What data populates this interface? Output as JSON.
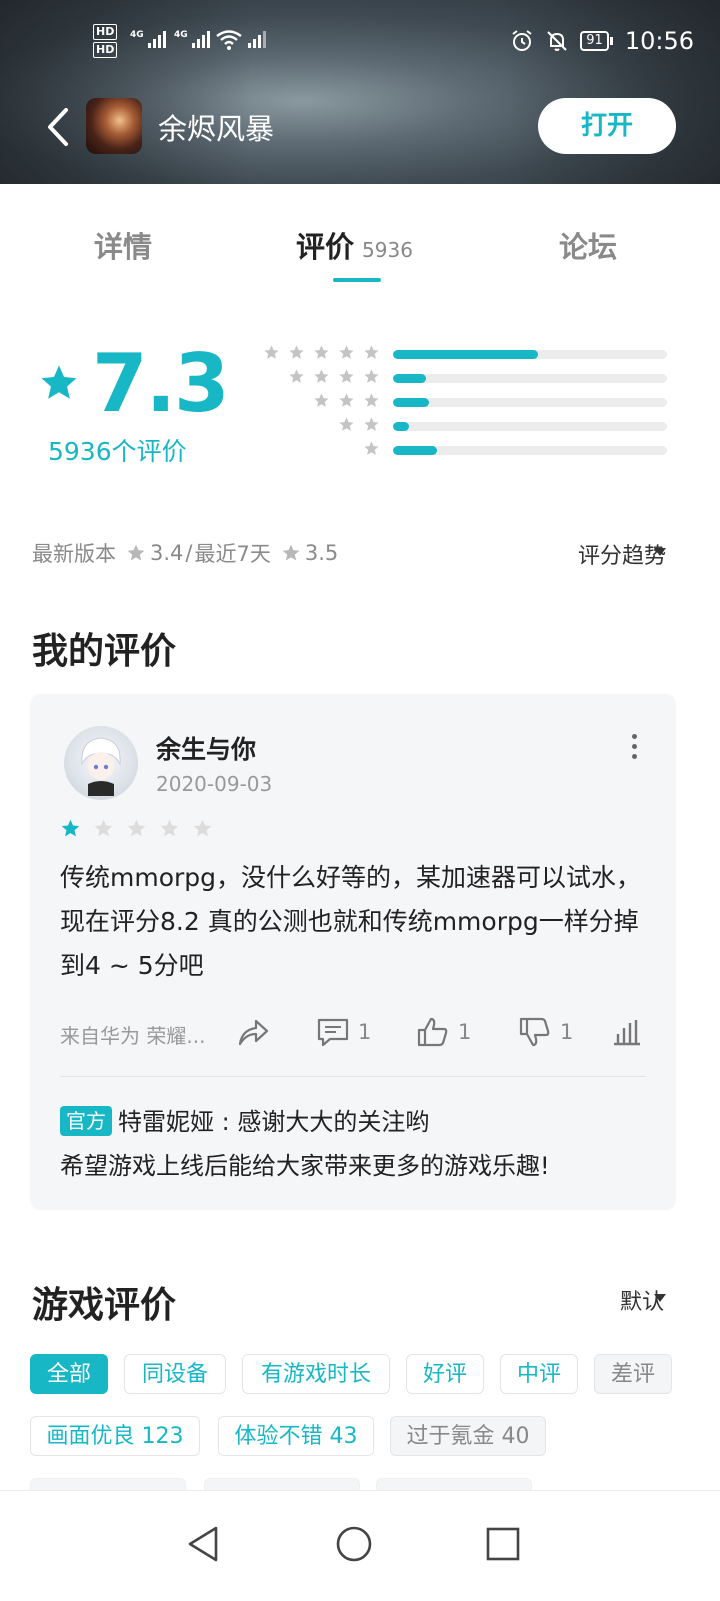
{
  "status_bar": {
    "time": "10:56",
    "battery": "91",
    "sim_labels": [
      "HD",
      "HD"
    ],
    "network_labels": [
      "4G",
      "4G"
    ]
  },
  "app_header": {
    "game_title": "余烬风暴",
    "open_button": "打开"
  },
  "tabs": [
    {
      "label": "详情"
    },
    {
      "label": "评价",
      "count": "5936"
    },
    {
      "label": "论坛"
    }
  ],
  "rating": {
    "score": "7.3",
    "count_text": "5936个评价",
    "distribution": [
      {
        "stars": 5,
        "fraction": 0.53
      },
      {
        "stars": 4,
        "fraction": 0.12
      },
      {
        "stars": 3,
        "fraction": 0.13
      },
      {
        "stars": 2,
        "fraction": 0.06
      },
      {
        "stars": 1,
        "fraction": 0.16
      }
    ],
    "latest_label": "最新版本",
    "latest_score": "3.4",
    "separator": "/",
    "recent_label": "最近7天",
    "recent_score": "3.5",
    "trend_label": "评分趋势"
  },
  "my_review": {
    "section_title": "我的评价",
    "user_name": "余生与你",
    "date": "2020-09-03",
    "stars": 1,
    "text": "传统mmorpg，没什么好等的，某加速器可以试水，现在评分8.2 真的公测也就和传统mmorpg一样分掉到4 ~ 5分吧",
    "device": "来自华为 荣耀...",
    "comment_count": "1",
    "like_count": "1",
    "dislike_count": "1",
    "official_badge": "官方",
    "official_reply_line1": "特雷妮娅 : 感谢大大的关注哟",
    "official_reply_line2": "希望游戏上线后能给大家带来更多的游戏乐趣!"
  },
  "game_reviews": {
    "section_title": "游戏评价",
    "sort_label": "默认",
    "filters": [
      "全部",
      "同设备",
      "有游戏时长",
      "好评",
      "中评",
      "差评"
    ],
    "tags": [
      "画面优良 123",
      "体验不错 43",
      "过于氪金 40"
    ]
  },
  "colors": {
    "accent": "#17b7c6",
    "card_bg": "#f5f6f8",
    "muted": "#8a8a8a"
  },
  "icons": [
    "back-arrow-icon",
    "star-icon",
    "more-vertical-icon",
    "share-icon",
    "comment-icon",
    "thumb-up-icon",
    "thumb-down-icon",
    "stats-icon",
    "caret-down-icon",
    "nav-back-icon",
    "nav-home-icon",
    "nav-recents-icon"
  ]
}
